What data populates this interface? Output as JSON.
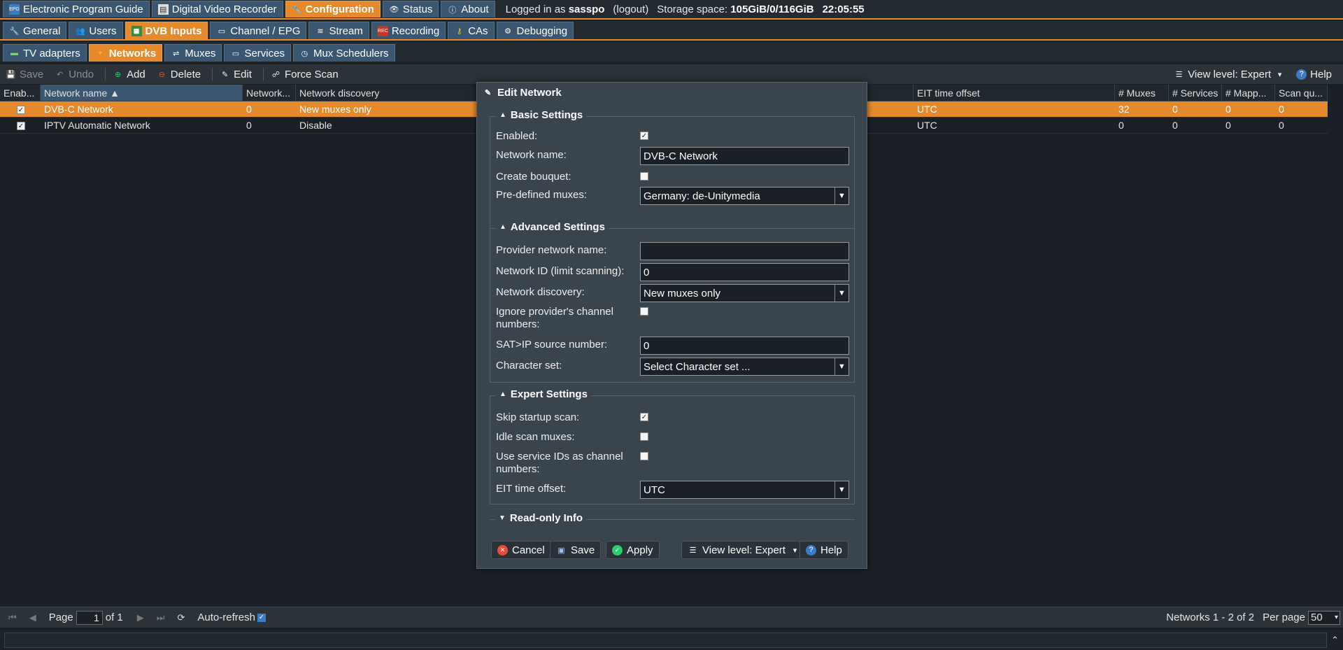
{
  "topnav": {
    "tabs": [
      {
        "icon": "epg-icon",
        "label": "Electronic Program Guide"
      },
      {
        "icon": "dvr-icon",
        "label": "Digital Video Recorder"
      },
      {
        "icon": "wrench-icon",
        "label": "Configuration"
      },
      {
        "icon": "eye-icon",
        "label": "Status"
      },
      {
        "icon": "info-icon",
        "label": "About"
      }
    ],
    "logged_prefix": "Logged in as",
    "user": "sasspo",
    "logout": "(logout)",
    "storage_label": "Storage space:",
    "storage_value": "105GiB/0/116GiB",
    "clock": "22:05:55"
  },
  "config_tabs": [
    {
      "icon": "wrench-icon",
      "label": "General"
    },
    {
      "icon": "users-icon",
      "label": "Users"
    },
    {
      "icon": "dvb-icon",
      "label": "DVB Inputs"
    },
    {
      "icon": "tv-icon",
      "label": "Channel / EPG"
    },
    {
      "icon": "stream-icon",
      "label": "Stream"
    },
    {
      "icon": "rec-icon",
      "label": "Recording"
    },
    {
      "icon": "key-icon",
      "label": "CAs"
    },
    {
      "icon": "bug-icon",
      "label": "Debugging"
    }
  ],
  "dvb_tabs": [
    {
      "icon": "adapter-icon",
      "label": "TV adapters"
    },
    {
      "icon": "network-icon",
      "label": "Networks"
    },
    {
      "icon": "mux-icon",
      "label": "Muxes"
    },
    {
      "icon": "monitor-icon",
      "label": "Services"
    },
    {
      "icon": "scheduler-icon",
      "label": "Mux Schedulers"
    }
  ],
  "toolbar": {
    "save": "Save",
    "undo": "Undo",
    "add": "Add",
    "delete": "Delete",
    "edit": "Edit",
    "force_scan": "Force Scan",
    "view_level": "View level: Expert",
    "help": "Help"
  },
  "grid": {
    "columns": [
      "Enab...",
      "Network name",
      "Network...",
      "Network discovery",
      "EIT time offset",
      "# Muxes",
      "# Services",
      "# Mapp...",
      "Scan qu..."
    ],
    "rows": [
      {
        "enabled": "✓",
        "name": "DVB-C Network",
        "netid": "0",
        "discovery": "New muxes only",
        "eit": "UTC",
        "muxes": "32",
        "services": "0",
        "mapped": "0",
        "scanq": "0"
      },
      {
        "enabled": "✓",
        "name": "IPTV Automatic Network",
        "netid": "0",
        "discovery": "Disable",
        "eit": "UTC",
        "muxes": "0",
        "services": "0",
        "mapped": "0",
        "scanq": "0"
      }
    ]
  },
  "modal": {
    "title": "Edit Network",
    "basic": {
      "legend": "Basic Settings",
      "enabled_label": "Enabled:",
      "enabled": "✓",
      "name_label": "Network name:",
      "name_value": "DVB-C Network",
      "bouquet_label": "Create bouquet:",
      "bouquet": "",
      "muxes_label": "Pre-defined muxes:",
      "muxes_value": "Germany: de-Unitymedia"
    },
    "advanced": {
      "legend": "Advanced Settings",
      "provider_label": "Provider network name:",
      "provider_value": "",
      "netid_label": "Network ID (limit scanning):",
      "netid_value": "0",
      "discovery_label": "Network discovery:",
      "discovery_value": "New muxes only",
      "ignore_label": "Ignore provider's channel numbers:",
      "ignore": "",
      "satip_label": "SAT>IP source number:",
      "satip_value": "0",
      "charset_label": "Character set:",
      "charset_value": "Select Character set ..."
    },
    "expert": {
      "legend": "Expert Settings",
      "skip_label": "Skip startup scan:",
      "skip": "✓",
      "idle_label": "Idle scan muxes:",
      "idle": "",
      "sid_label": "Use service IDs as channel numbers:",
      "sid": "",
      "eit_label": "EIT time offset:",
      "eit_value": "UTC"
    },
    "readonly_legend": "Read-only Info",
    "buttons": {
      "cancel": "Cancel",
      "save": "Save",
      "apply": "Apply",
      "view_level": "View level: Expert",
      "help": "Help"
    }
  },
  "pager": {
    "page_label": "Page",
    "page_value": "1",
    "of": "of 1",
    "autorefresh": "Auto-refresh",
    "summary": "Networks 1 - 2 of 2",
    "per_page_label": "Per page",
    "per_page_value": "50"
  },
  "colors": {
    "accent": "#e58a2c",
    "tab": "#3a5670",
    "background": "#1a2025",
    "modal": "#3a444d"
  }
}
